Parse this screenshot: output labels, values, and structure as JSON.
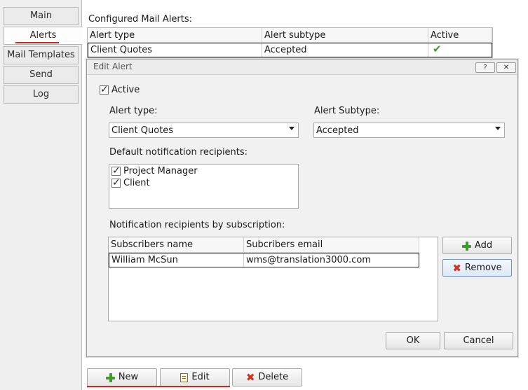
{
  "nav": {
    "items": [
      {
        "label": "Main"
      },
      {
        "label": "Alerts"
      },
      {
        "label": "Mail Templates"
      },
      {
        "label": "Send"
      },
      {
        "label": "Log"
      }
    ],
    "active": "Alerts"
  },
  "main": {
    "section_label": "Configured Mail Alerts:",
    "columns": [
      "Alert type",
      "Alert subtype",
      "Active"
    ],
    "rows": [
      {
        "type": "Client Quotes",
        "subtype": "Accepted",
        "active": true
      }
    ]
  },
  "dialog": {
    "title": "Edit Alert",
    "help_button": "?",
    "close_button": "✕",
    "active_label": "Active",
    "active_checked": true,
    "alert_type_label": "Alert type:",
    "alert_type_value": "Client Quotes",
    "alert_subtype_label": "Alert Subtype:",
    "alert_subtype_value": "Accepted",
    "default_recipients_label": "Default notification recipients:",
    "default_recipients": [
      {
        "label": "Project Manager",
        "checked": true
      },
      {
        "label": "Client",
        "checked": true
      }
    ],
    "subscription_label": "Notification recipients by subscription:",
    "sub_columns": [
      "Subscribers name",
      "Subcribers email"
    ],
    "subscribers": [
      {
        "name": "William McSun",
        "email": "wms@translation3000.com"
      }
    ],
    "add_label": "Add",
    "remove_label": "Remove",
    "ok_label": "OK",
    "cancel_label": "Cancel"
  },
  "toolbar": {
    "new_label": "New",
    "edit_label": "Edit",
    "delete_label": "Delete"
  },
  "colors": {
    "accent_underline": "#d9241b",
    "check_green": "#3f9b2f",
    "remove_red": "#d6301f"
  }
}
